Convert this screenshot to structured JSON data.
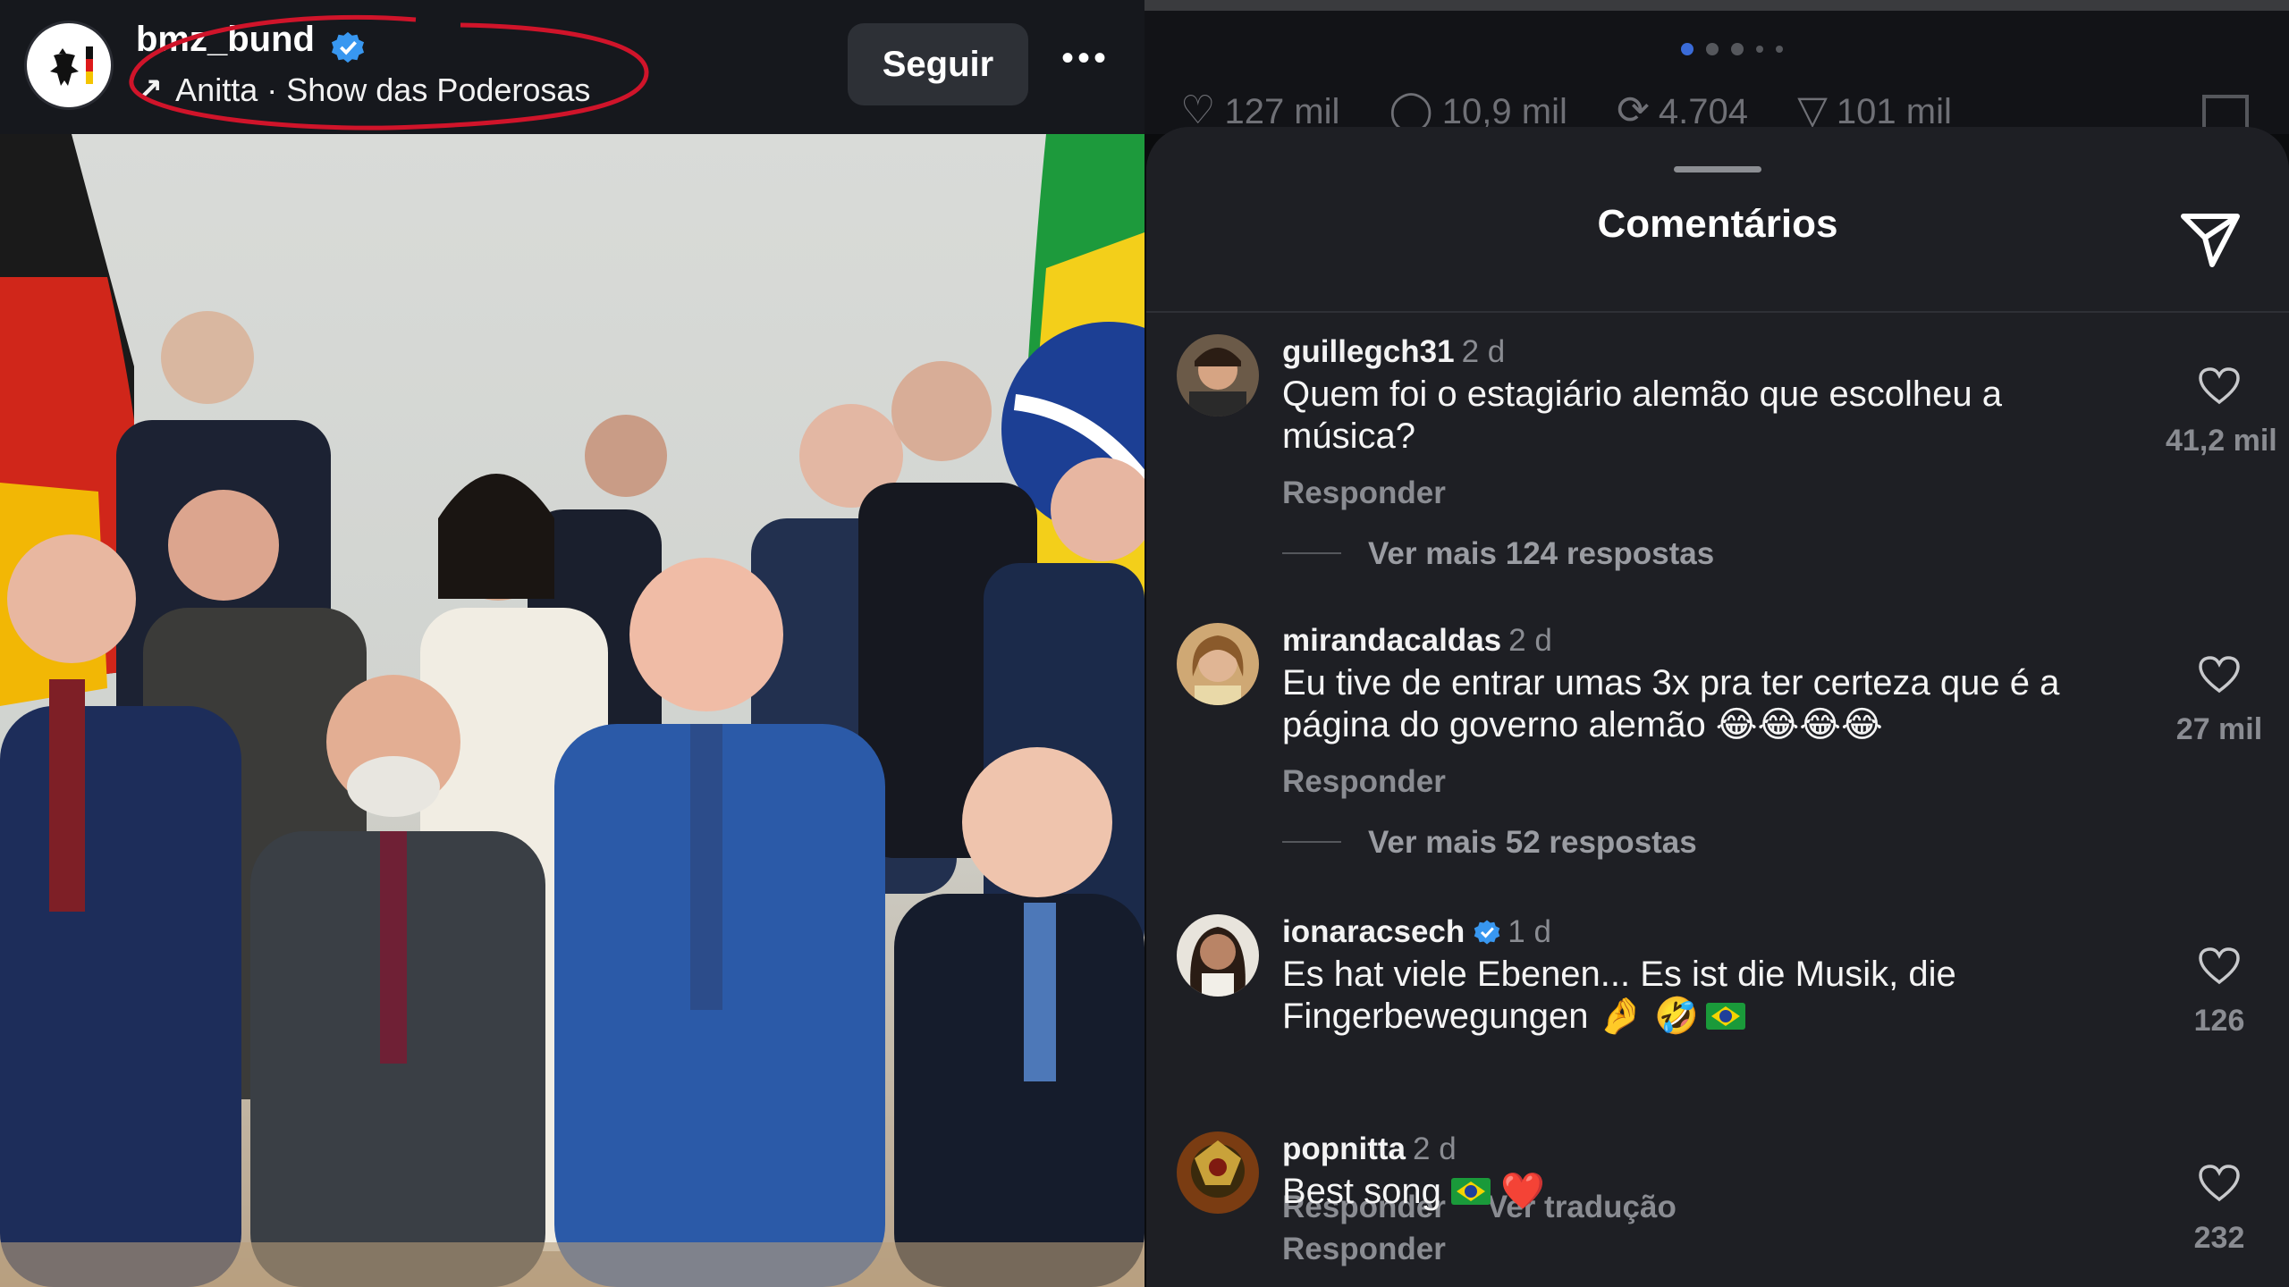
{
  "post": {
    "username": "bmz_bund",
    "music": "Anitta · Show das Poderosas",
    "follow_label": "Seguir",
    "more_label": "•••"
  },
  "stats_behind": {
    "likes": "127 mil",
    "comments": "10,9 mil",
    "reposts": "4.704",
    "shares": "101 mil"
  },
  "sheet": {
    "title": "Comentários"
  },
  "comments": [
    {
      "user": "guillegch31",
      "time": "2 d",
      "verified": false,
      "text": "Quem foi o estagiário alemão que escolheu a música?",
      "reply_label": "Responder",
      "more_replies": "Ver mais 124 respostas",
      "likes": "41,2 mil"
    },
    {
      "user": "mirandacaldas",
      "time": "2 d",
      "verified": false,
      "text": "Eu tive de entrar umas 3x pra ter certeza que é a página do governo alemão 😂😂😂😂",
      "reply_label": "Responder",
      "more_replies": "Ver mais 52 respostas",
      "likes": "27 mil"
    },
    {
      "user": "ionaracsech",
      "time": "1 d",
      "verified": true,
      "text": "Es hat viele Ebenen... Es ist die Musik, die Fingerbewegungen",
      "text_emoji_tail": "🤌 🤣",
      "reply_label": "Responder",
      "translate_label": "Ver tradução",
      "likes": "126"
    },
    {
      "user": "popnitta",
      "time": "2 d",
      "verified": false,
      "text": "Best song",
      "text_emoji_tail": "❤️",
      "reply_label": "Responder",
      "likes": "232"
    }
  ],
  "colors": {
    "accent_blue": "#3897f0",
    "annotation_red": "#d0142a",
    "sheet_bg": "#1e1f24"
  },
  "icons": [
    "verified-badge-icon",
    "music-arrow-icon",
    "more-icon",
    "send-icon",
    "heart-icon",
    "comment-icon",
    "repost-icon",
    "share-icon",
    "bookmark-icon"
  ]
}
